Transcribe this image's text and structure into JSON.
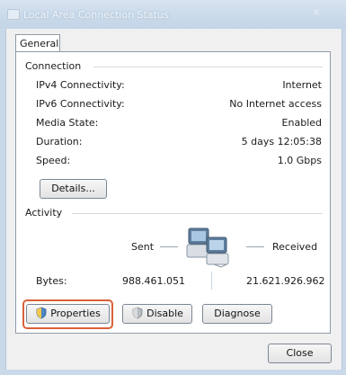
{
  "window": {
    "title": "Local Area Connection Status",
    "close_label": "✕"
  },
  "tabs": {
    "general": "General"
  },
  "connection": {
    "heading": "Connection",
    "rows": [
      {
        "label": "IPv4 Connectivity:",
        "value": "Internet"
      },
      {
        "label": "IPv6 Connectivity:",
        "value": "No Internet access"
      },
      {
        "label": "Media State:",
        "value": "Enabled"
      },
      {
        "label": "Duration:",
        "value": "5 days 12:05:38"
      },
      {
        "label": "Speed:",
        "value": "1.0 Gbps"
      }
    ],
    "details_button": "Details..."
  },
  "activity": {
    "heading": "Activity",
    "sent_label": "Sent",
    "received_label": "Received",
    "bytes_label": "Bytes:",
    "bytes_sent": "988.461.051",
    "bytes_received": "21.621.926.962"
  },
  "buttons": {
    "properties": "Properties",
    "disable": "Disable",
    "diagnose": "Diagnose",
    "close": "Close"
  },
  "icons": {
    "shield": "shield-icon",
    "network": "network-computers-icon"
  },
  "colors": {
    "highlight": "#d9613a",
    "title_bar": "#c9d9ea"
  }
}
